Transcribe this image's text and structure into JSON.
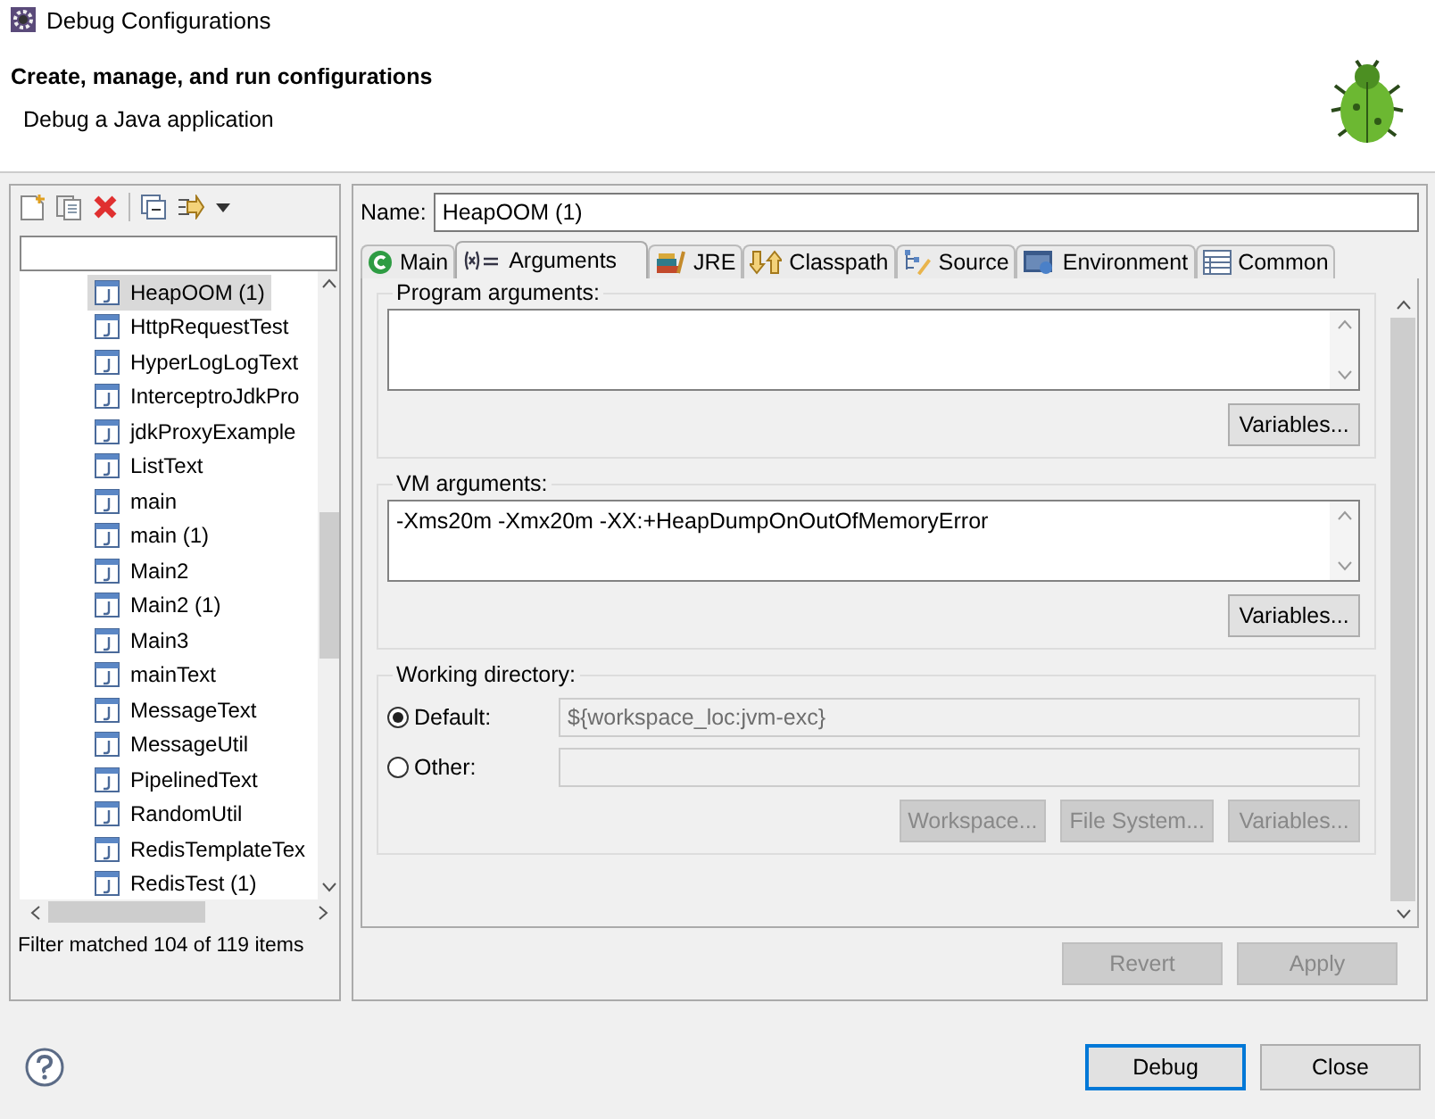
{
  "window": {
    "title": "Debug Configurations"
  },
  "header": {
    "title": "Create, manage, and run configurations",
    "subtitle": "Debug a Java application"
  },
  "sidebar": {
    "items": [
      {
        "label": "HeapOOM (1)",
        "selected": true
      },
      {
        "label": "HttpRequestTest",
        "selected": false
      },
      {
        "label": "HyperLogLogText",
        "selected": false
      },
      {
        "label": "InterceptroJdkPro",
        "selected": false
      },
      {
        "label": "jdkProxyExample",
        "selected": false
      },
      {
        "label": "ListText",
        "selected": false
      },
      {
        "label": "main",
        "selected": false
      },
      {
        "label": "main (1)",
        "selected": false
      },
      {
        "label": "Main2",
        "selected": false
      },
      {
        "label": "Main2 (1)",
        "selected": false
      },
      {
        "label": "Main3",
        "selected": false
      },
      {
        "label": "mainText",
        "selected": false
      },
      {
        "label": "MessageText",
        "selected": false
      },
      {
        "label": "MessageUtil",
        "selected": false
      },
      {
        "label": "PipelinedText",
        "selected": false
      },
      {
        "label": "RandomUtil",
        "selected": false
      },
      {
        "label": "RedisTemplateTex",
        "selected": false
      },
      {
        "label": "RedisTest (1)",
        "selected": false
      }
    ],
    "status": "Filter matched 104 of 119 items"
  },
  "name_field": {
    "label": "Name:",
    "value": "HeapOOM (1)"
  },
  "tabs": [
    {
      "label": "Main",
      "selected": false
    },
    {
      "label": "Arguments",
      "selected": true
    },
    {
      "label": "JRE",
      "selected": false
    },
    {
      "label": "Classpath",
      "selected": false
    },
    {
      "label": "Source",
      "selected": false
    },
    {
      "label": "Environment",
      "selected": false
    },
    {
      "label": "Common",
      "selected": false
    }
  ],
  "program_arguments": {
    "label": "Program arguments:",
    "button": {
      "label": "Variables...",
      "disabled": false
    }
  },
  "vm_arguments": {
    "label": "VM arguments:",
    "value": "-Xms20m -Xmx20m  -XX:+HeapDumpOnOutOfMemoryError",
    "button": {
      "label": "Variables...",
      "disabled": false
    }
  },
  "working_directory": {
    "label": "Working directory:",
    "options": [
      {
        "label": "Default:",
        "selected": true,
        "value": "${workspace_loc:jvm-exc}"
      },
      {
        "label": "Other:",
        "selected": false
      }
    ],
    "buttons": [
      {
        "label": "Workspace...",
        "disabled": true
      },
      {
        "label": "File System...",
        "disabled": true
      },
      {
        "label": "Variables...",
        "disabled": true
      }
    ]
  },
  "panel_buttons": [
    {
      "label": "Revert",
      "disabled": true
    },
    {
      "label": "Apply",
      "disabled": true
    }
  ],
  "dialog_buttons": [
    {
      "label": "Debug",
      "disabled": false,
      "default": true
    },
    {
      "label": "Close",
      "disabled": false,
      "default": false
    }
  ]
}
